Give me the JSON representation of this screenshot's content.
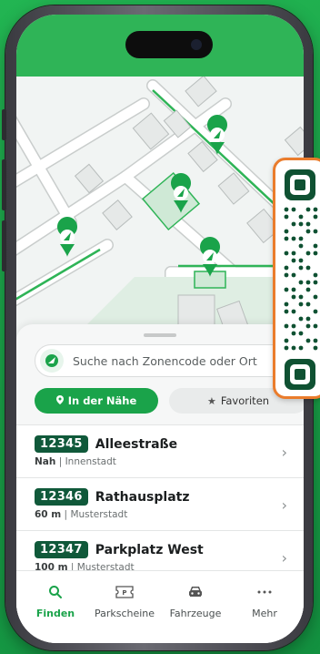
{
  "search": {
    "placeholder": "Suche nach Zonencode oder Ort"
  },
  "tabs": [
    {
      "label": "In der Nähe",
      "icon": "location-pin-icon",
      "active": true
    },
    {
      "label": "Favoriten",
      "icon": "star-icon",
      "active": false
    }
  ],
  "zones": [
    {
      "code": "12345",
      "name": "Alleestraße",
      "distance": "Nah",
      "area": "Innenstadt"
    },
    {
      "code": "12346",
      "name": "Rathausplatz",
      "distance": "60 m",
      "area": "Musterstadt"
    },
    {
      "code": "12347",
      "name": "Parkplatz West",
      "distance": "100 m",
      "area": "Musterstadt"
    }
  ],
  "nav": [
    {
      "label": "Finden",
      "icon": "search-icon",
      "active": true
    },
    {
      "label": "Parkscheine",
      "icon": "ticket-icon",
      "active": false
    },
    {
      "label": "Fahrzeuge",
      "icon": "car-icon",
      "active": false
    },
    {
      "label": "Mehr",
      "icon": "more-icon",
      "active": false
    }
  ],
  "colors": {
    "brand": "#1aa34a",
    "brand_dark": "#10593a",
    "accent": "#ea7c2c"
  }
}
